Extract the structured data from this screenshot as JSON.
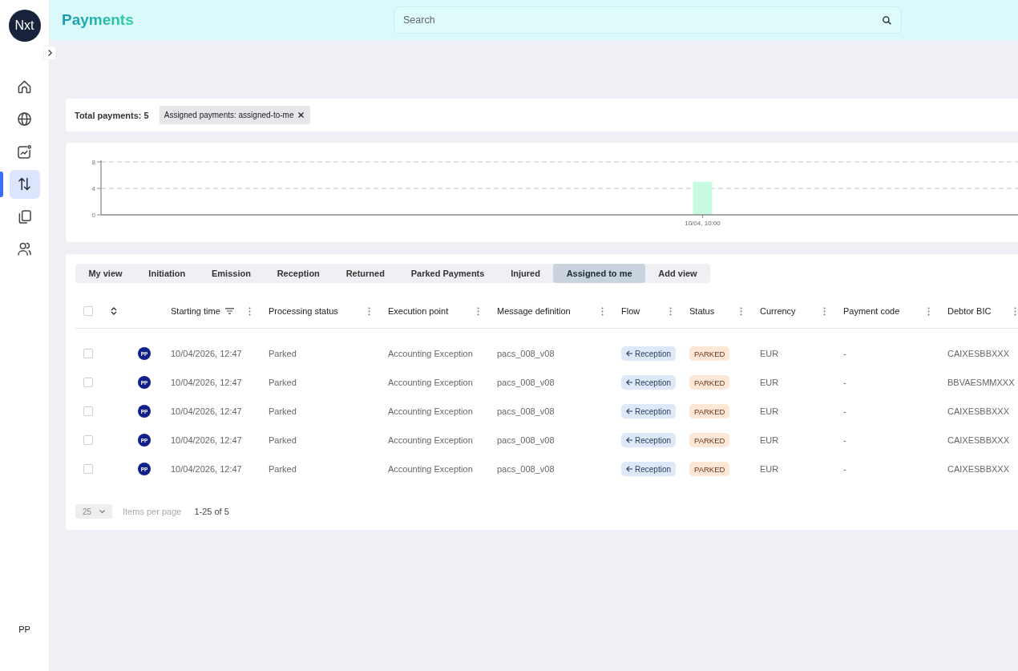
{
  "sidebar": {
    "logo": "Nxt",
    "items": [
      {
        "selected": false
      },
      {
        "selected": false
      },
      {
        "selected": false
      },
      {
        "selected": true
      },
      {
        "selected": false
      },
      {
        "selected": false
      }
    ],
    "user": "PP"
  },
  "header": {
    "title": "Payments",
    "search": {
      "placeholder": "Search"
    }
  },
  "summary": {
    "total": "Total payments: 5",
    "chips": [
      {
        "label": "Assigned payments: assigned-to-me"
      }
    ]
  },
  "chart": {
    "chart_data": {
      "type": "bar",
      "categories": [
        "10/04, 10:00"
      ],
      "values": [
        5
      ],
      "ylim": [
        0,
        8
      ],
      "yticks": [
        0,
        4,
        8
      ]
    }
  },
  "views": {
    "tabs": [
      {
        "label": "My view",
        "selected": false
      },
      {
        "label": "Initiation",
        "selected": false
      },
      {
        "label": "Emission",
        "selected": false
      },
      {
        "label": "Reception",
        "selected": false
      },
      {
        "label": "Returned",
        "selected": false
      },
      {
        "label": "Parked Payments",
        "selected": false
      },
      {
        "label": "Injured",
        "selected": false
      },
      {
        "label": "Assigned to me",
        "selected": true
      }
    ],
    "add_button": "Add view"
  },
  "table": {
    "select_all": {
      "checked": false
    },
    "columns": [
      {
        "label": "Starting time",
        "kind": "text",
        "sorted": true
      },
      {
        "label": "Processing status",
        "kind": "text",
        "sorted": false
      },
      {
        "label": "Execution point",
        "kind": "text",
        "sorted": false
      },
      {
        "label": "Message definition",
        "kind": "text",
        "sorted": false
      },
      {
        "label": "Flow",
        "kind": "flow",
        "sorted": false
      },
      {
        "label": "Status",
        "kind": "status",
        "sorted": false
      },
      {
        "label": "Currency",
        "kind": "text",
        "sorted": false
      },
      {
        "label": "Payment code",
        "kind": "text",
        "sorted": false
      },
      {
        "label": "Debtor BIC",
        "kind": "text",
        "sorted": false
      }
    ],
    "rows": [
      {
        "checked": false,
        "assignee": "PP",
        "cells": [
          "10/04/2026, 12:47",
          "Parked",
          "Accounting Exception",
          "pacs_008_v08",
          "Reception",
          "PARKED",
          "EUR",
          "-",
          "CAIXESBBXXX"
        ]
      },
      {
        "checked": false,
        "assignee": "PP",
        "cells": [
          "10/04/2026, 12:47",
          "Parked",
          "Accounting Exception",
          "pacs_008_v08",
          "Reception",
          "PARKED",
          "EUR",
          "-",
          "BBVAESMMXXX"
        ]
      },
      {
        "checked": false,
        "assignee": "PP",
        "cells": [
          "10/04/2026, 12:47",
          "Parked",
          "Accounting Exception",
          "pacs_008_v08",
          "Reception",
          "PARKED",
          "EUR",
          "-",
          "CAIXESBBXXX"
        ]
      },
      {
        "checked": false,
        "assignee": "PP",
        "cells": [
          "10/04/2026, 12:47",
          "Parked",
          "Accounting Exception",
          "pacs_008_v08",
          "Reception",
          "PARKED",
          "EUR",
          "-",
          "CAIXESBBXXX"
        ]
      },
      {
        "checked": false,
        "assignee": "PP",
        "cells": [
          "10/04/2026, 12:47",
          "Parked",
          "Accounting Exception",
          "pacs_008_v08",
          "Reception",
          "PARKED",
          "EUR",
          "-",
          "CAIXESBBXXX"
        ]
      }
    ]
  },
  "pagination": {
    "page_size": "25",
    "label": "Items per page",
    "range": "1-25 of 5"
  }
}
